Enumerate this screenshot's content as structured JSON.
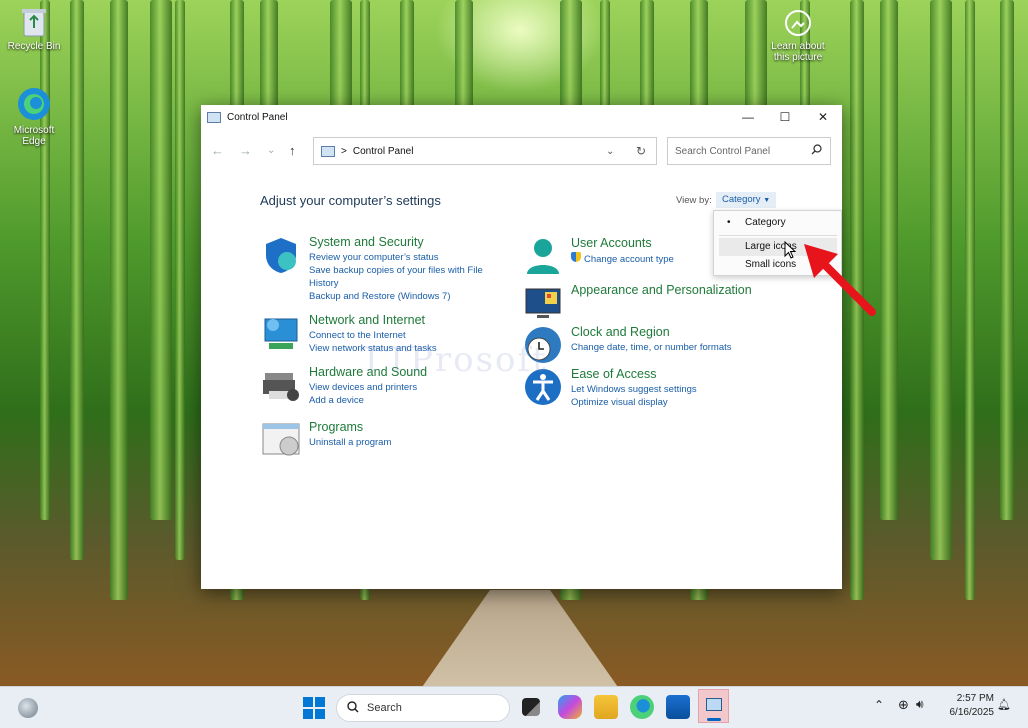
{
  "desktop": {
    "icons": [
      {
        "label": "Recycle Bin",
        "icon": "recycle-bin-icon"
      },
      {
        "label": "Microsoft Edge",
        "icon": "edge-icon"
      },
      {
        "label": "Learn about this picture",
        "icon": "camera-info-icon"
      }
    ]
  },
  "window": {
    "title": "Control Panel",
    "controls": {
      "minimize": "—",
      "maximize": "☐",
      "close": "✕"
    },
    "address": {
      "separator": ">",
      "location": "Control Panel"
    },
    "search_placeholder": "Search Control Panel",
    "heading": "Adjust your computer’s settings",
    "view_by_label": "View by:",
    "view_by_value": "Category"
  },
  "categories": [
    {
      "title": "System and Security",
      "links": [
        "Review your computer’s status",
        "Save backup copies of your files with File",
        "History",
        "Backup and Restore (Windows 7)"
      ]
    },
    {
      "title": "Network and Internet",
      "links": [
        "Connect to the Internet",
        "View network status and tasks"
      ]
    },
    {
      "title": "Hardware and Sound",
      "links": [
        "View devices and printers",
        "Add a device"
      ]
    },
    {
      "title": "Programs",
      "links": [
        "Uninstall a program"
      ]
    },
    {
      "title": "User Accounts",
      "links": [
        "Change account type"
      ]
    },
    {
      "title": "Appearance and Personalization",
      "links": []
    },
    {
      "title": "Clock and Region",
      "links": [
        "Change date, time, or number formats"
      ]
    },
    {
      "title": "Ease of Access",
      "links": [
        "Let Windows suggest settings",
        "Optimize visual display"
      ]
    }
  ],
  "view_menu": {
    "items": [
      "Category",
      "Large icons",
      "Small icons"
    ],
    "selected": "Category",
    "hovered": "Large icons"
  },
  "watermark": "TTProsoft",
  "taskbar": {
    "search_placeholder": "Search",
    "time": "2:57 PM",
    "date": "6/16/2025",
    "accent": "#0067c0"
  }
}
